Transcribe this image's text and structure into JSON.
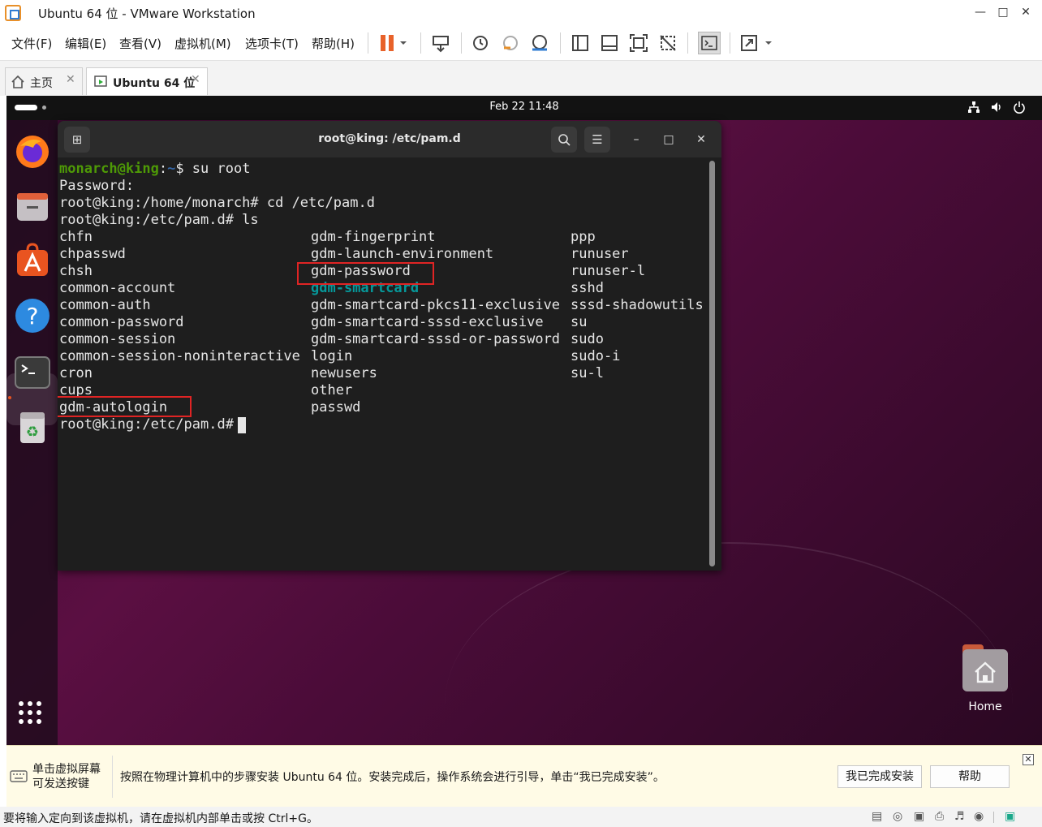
{
  "window": {
    "title": "Ubuntu 64 位 - VMware Workstation"
  },
  "menu": [
    "文件(F)",
    "编辑(E)",
    "查看(V)",
    "虚拟机(M)",
    "选项卡(T)",
    "帮助(H)"
  ],
  "tabs": [
    {
      "label": "主页",
      "icon": "home-icon"
    },
    {
      "label": "Ubuntu 64 位",
      "icon": "vm-running-icon"
    }
  ],
  "guest": {
    "topbar": {
      "clock": "Feb 22  11:48"
    },
    "dock": [
      "firefox-icon",
      "files-icon",
      "app-center-icon",
      "help-icon",
      "terminal-icon",
      "trash-icon",
      "app-grid-icon"
    ],
    "desktop_icons": [
      {
        "label": "Home"
      }
    ]
  },
  "terminal": {
    "title": "root@king: /etc/pam.d",
    "prompt_user": "monarch@king",
    "prompt_path": "~",
    "cmd1": "$ su root",
    "line_password": "Password:",
    "line_cd": "root@king:/home/monarch# cd /etc/pam.d",
    "line_ls": "root@king:/etc/pam.d# ls",
    "col1": [
      "chfn",
      "chpasswd",
      "chsh",
      "common-account",
      "common-auth",
      "common-password",
      "common-session",
      "common-session-noninteractive",
      "cron",
      "cups",
      "gdm-autologin"
    ],
    "col2": [
      "gdm-fingerprint",
      "gdm-launch-environment",
      "gdm-password",
      "gdm-smartcard",
      "gdm-smartcard-pkcs11-exclusive",
      "gdm-smartcard-sssd-exclusive",
      "gdm-smartcard-sssd-or-password",
      "login",
      "newusers",
      "other",
      "passwd"
    ],
    "col3": [
      "ppp",
      "runuser",
      "runuser-l",
      "sshd",
      "sssd-shadowutils",
      "su",
      "sudo",
      "sudo-i",
      "su-l"
    ],
    "final_prompt": "root@king:/etc/pam.d# "
  },
  "hint_bar": {
    "left_line1": "单击虚拟屏幕",
    "left_line2": "可发送按键",
    "message": "按照在物理计算机中的步骤安装 Ubuntu 64 位。安装完成后，操作系统会进行引导，单击“我已完成安装”。",
    "done_button": "我已完成安装",
    "help_button": "帮助"
  },
  "status_bar": {
    "text": "要将输入定向到该虚拟机，请在虚拟机内部单击或按 Ctrl+G。"
  },
  "colors": {
    "accent_red_box": "#e02424",
    "prompt_green": "#4e9a06",
    "path_blue": "#3465a4",
    "dir_cyan": "#06989a"
  }
}
